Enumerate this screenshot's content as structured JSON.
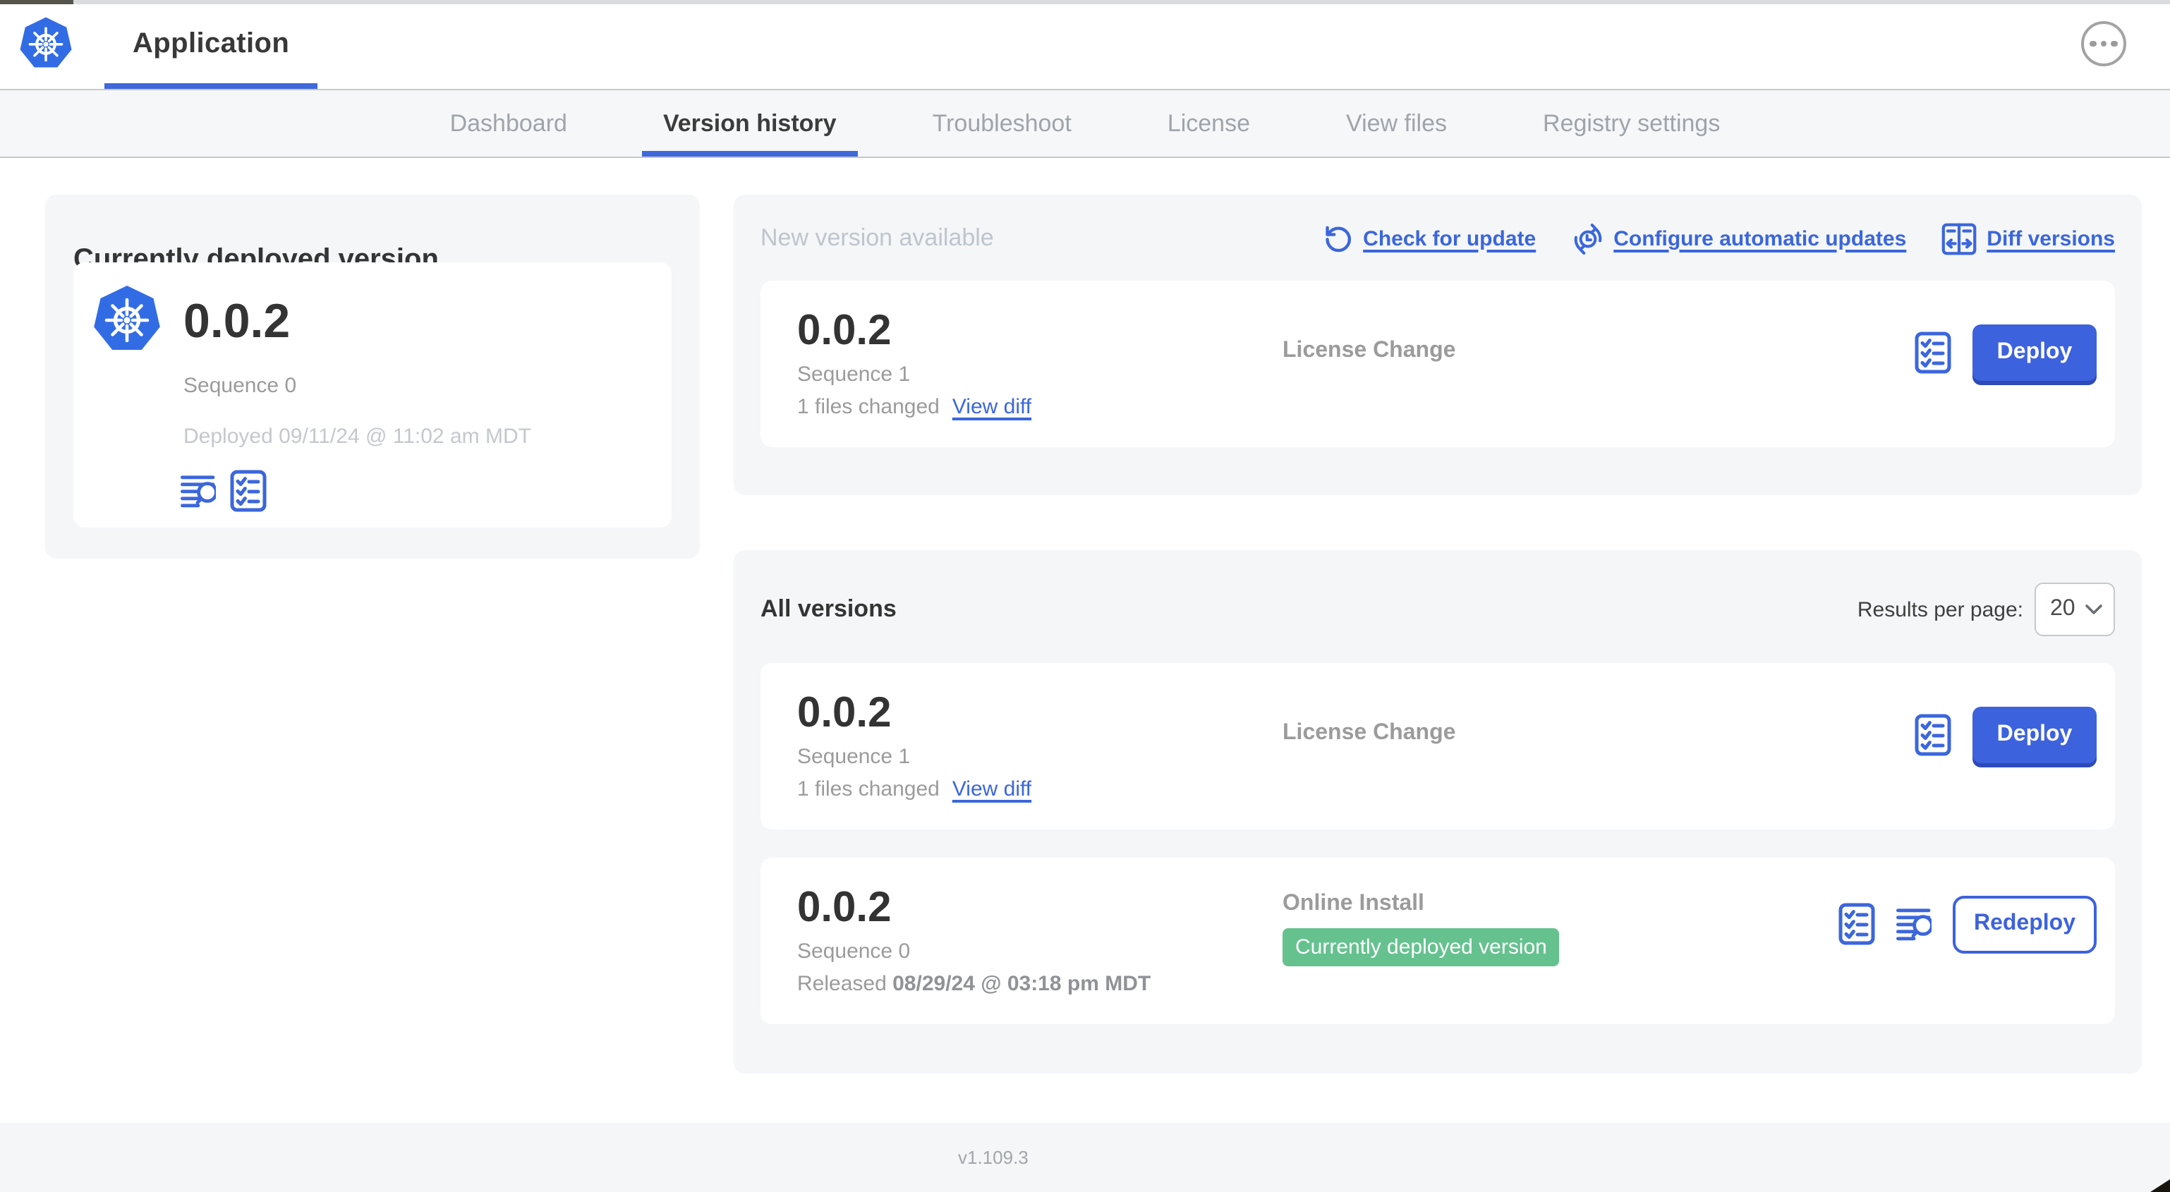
{
  "header": {
    "title": "Application"
  },
  "nav": {
    "tabs": [
      "Dashboard",
      "Version history",
      "Troubleshoot",
      "License",
      "View files",
      "Registry settings"
    ],
    "active_tab": "Version history"
  },
  "current_version": {
    "heading": "Currently deployed version",
    "version": "0.0.2",
    "sequence": "Sequence 0",
    "deployed": "Deployed 09/11/24 @ 11:02 am MDT"
  },
  "new_version": {
    "heading": "New version available",
    "actions": {
      "check_for_update": "Check for update",
      "configure_automatic_updates": "Configure automatic updates",
      "diff_versions": "Diff versions"
    },
    "row": {
      "version": "0.0.2",
      "sequence": "Sequence 1",
      "files_changed": "1 files changed",
      "view_diff_label": "View diff",
      "source": "License Change",
      "deploy_label": "Deploy"
    }
  },
  "all_versions": {
    "heading": "All versions",
    "results_per_page_label": "Results per page:",
    "results_per_page_value": "20",
    "rows": [
      {
        "version": "0.0.2",
        "sequence": "Sequence 1",
        "files_changed": "1 files changed",
        "view_diff_label": "View diff",
        "source": "License Change",
        "deploy_label": "Deploy"
      },
      {
        "version": "0.0.2",
        "sequence": "Sequence 0",
        "released_prefix": "Released",
        "released_date": "08/29/24 @ 03:18 pm MDT",
        "source": "Online Install",
        "badge": "Currently deployed version",
        "redeploy_label": "Redeploy"
      }
    ]
  },
  "footer": {
    "app_version": "v1.109.3"
  },
  "icons": {
    "app_logo": "kubernetes-helm-wheel",
    "more_options": "ellipsis-circle",
    "check_for_update": "rotate-ccw-arrow",
    "configure_automatic_updates": "clock-refresh",
    "diff_versions": "split-pane-diff-arrows",
    "preflight_checks": "checklist",
    "view_logs": "log-lines-magnifier",
    "results_select": "chevron-down"
  },
  "colors": {
    "primary_blue": "#3d62dd",
    "link_blue": "#3b66dc",
    "logo_blue": "#326ce5",
    "badge_green": "#65c28f",
    "muted_text": "#9b9b9b",
    "light_muted_text": "#c4c8cd",
    "section_bg": "#f4f6f8",
    "dark_text": "#343434"
  }
}
